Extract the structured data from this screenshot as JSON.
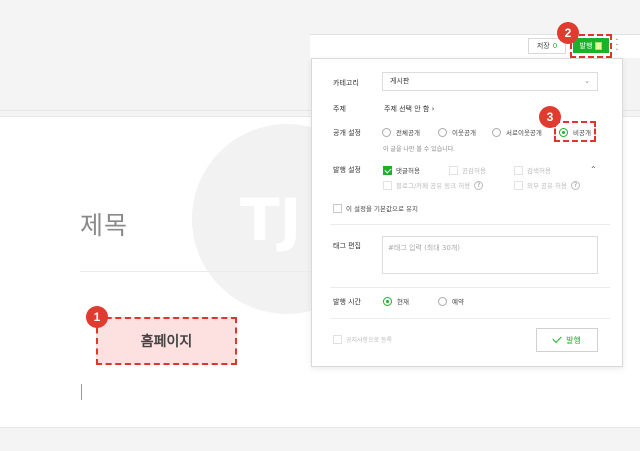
{
  "editor": {
    "title_placeholder": "제목",
    "homepage_text": "홈페이지"
  },
  "toolbar": {
    "save_label": "저장",
    "save_count": "0",
    "publish_label": "발행",
    "more_icon": "more-vertical-icon"
  },
  "badges": [
    "1",
    "2",
    "3"
  ],
  "panel": {
    "category": {
      "label": "카테고리",
      "value": "게시판"
    },
    "topic": {
      "label": "주제",
      "value": "주제 선택 안 함"
    },
    "visibility": {
      "label": "공개 설정",
      "options": [
        "전체공개",
        "이웃공개",
        "서로이웃공개",
        "비공개"
      ],
      "selected": "비공개",
      "hint": "이 글을 나만 볼 수 있습니다."
    },
    "publish_settings": {
      "label": "발행 설정",
      "options": [
        {
          "text": "댓글허용",
          "checked": true,
          "enabled": true
        },
        {
          "text": "공감허용",
          "checked": false,
          "enabled": false
        },
        {
          "text": "검색허용",
          "checked": false,
          "enabled": false
        },
        {
          "text": "블로그/카페 공유 링크 허용",
          "checked": false,
          "enabled": false
        },
        {
          "text": "외부 공유 허용",
          "checked": false,
          "enabled": false
        }
      ]
    },
    "default_keep": "이 설정을 기본값으로 유지",
    "tag": {
      "label": "태그 편집",
      "placeholder": "#태그 입력 (최대 30개)"
    },
    "publish_time": {
      "label": "발행 시간",
      "options": [
        "현재",
        "예약"
      ],
      "selected": "현재"
    },
    "notice_label": "공지사항으로 등록",
    "publish_button": "발행"
  },
  "colors": {
    "accent": "#19b22a",
    "highlight": "#e0342f",
    "highlight_fill": "#fde1e1"
  }
}
